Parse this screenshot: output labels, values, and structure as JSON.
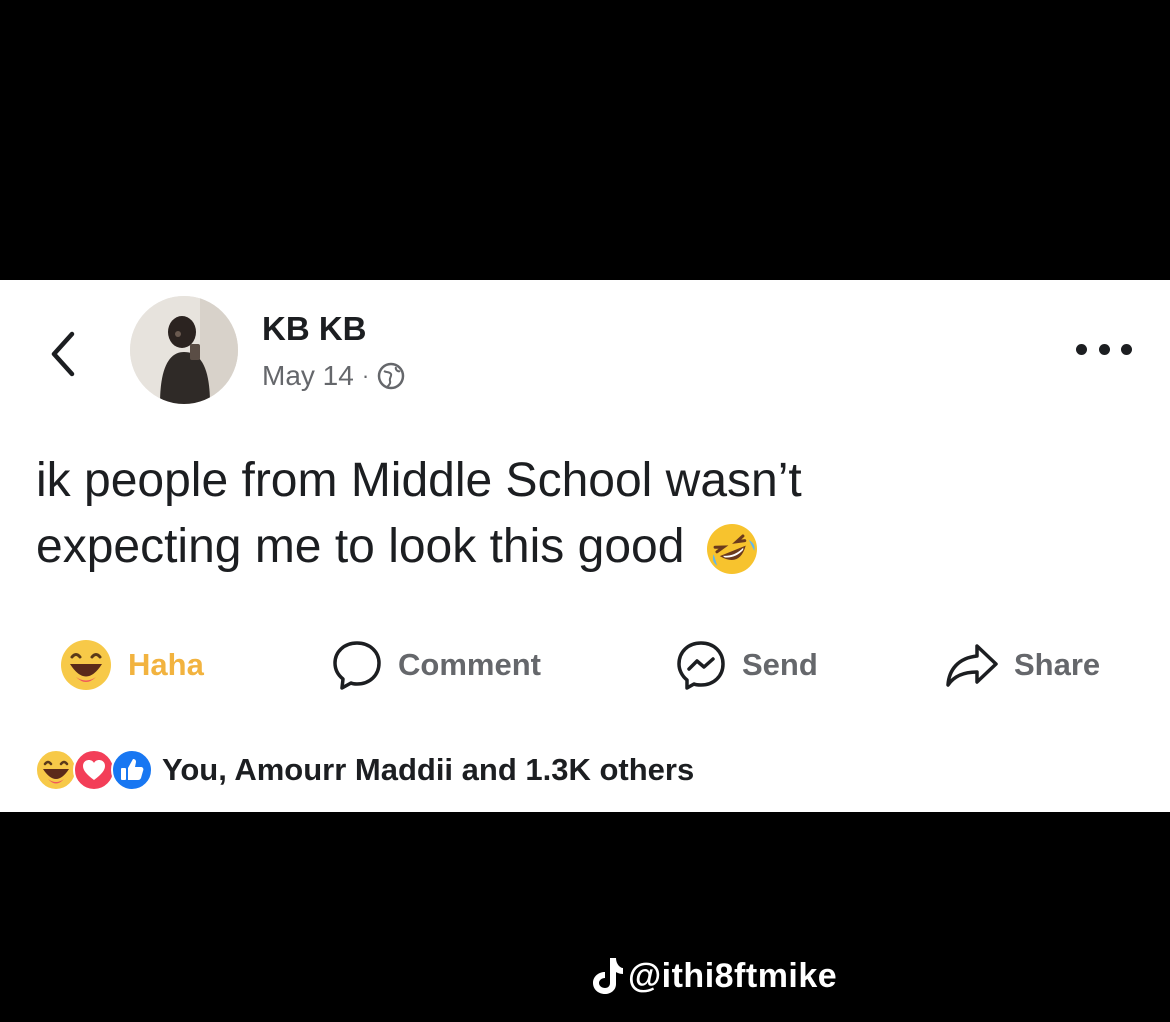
{
  "post": {
    "author": "KB KB",
    "date": "May 14",
    "separator": "·",
    "text_line1": "ik people from Middle School wasn’t",
    "text_line2": "expecting me to look this good"
  },
  "actions": {
    "haha_label": "Haha",
    "comment_label": "Comment",
    "send_label": "Send",
    "share_label": "Share"
  },
  "reactions": {
    "summary": "You, Amourr Maddii and 1.3K others"
  },
  "watermark": {
    "handle": "@ithi8ftmike"
  },
  "colors": {
    "background": "#000000",
    "card": "#ffffff",
    "haha_accent": "#f2b33f",
    "muted_text": "#65676b",
    "primary_text": "#1c1e21",
    "like_blue": "#1877f2",
    "love_red": "#f33e58"
  },
  "icons": [
    "back-chevron-icon",
    "globe-icon",
    "more-dots-icon",
    "rofl-emoji-icon",
    "haha-reaction-icon",
    "comment-icon",
    "messenger-icon",
    "share-arrow-icon",
    "love-reaction-icon",
    "like-reaction-icon",
    "tiktok-logo-icon"
  ]
}
